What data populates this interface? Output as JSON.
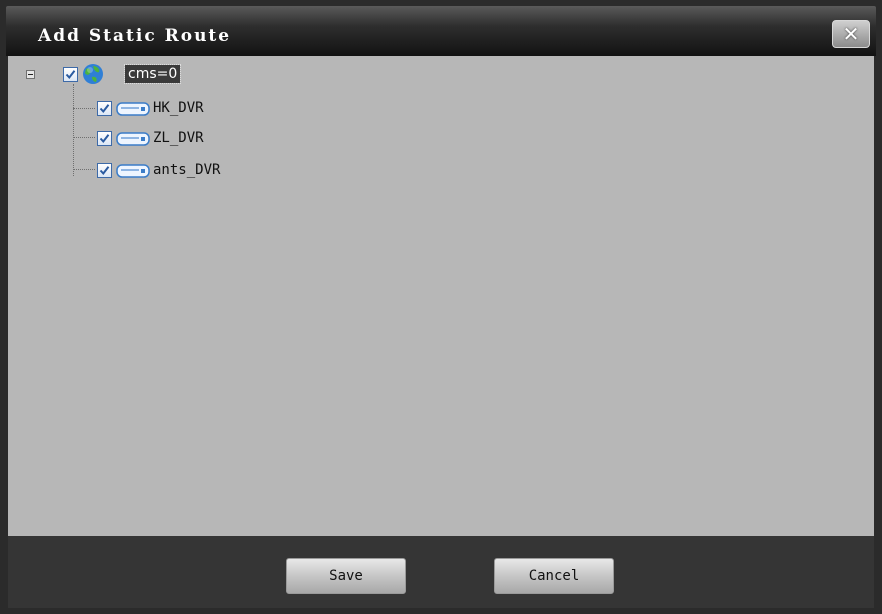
{
  "dialog": {
    "title": "Add Static Route",
    "close_glyph": "✕"
  },
  "tree": {
    "root": {
      "label": "cms=0",
      "checked": true,
      "expanded": true,
      "icon": "globe-icon",
      "children": [
        {
          "label": "HK_DVR",
          "checked": true,
          "icon": "dvr-device-icon"
        },
        {
          "label": "ZL_DVR",
          "checked": true,
          "icon": "dvr-device-icon"
        },
        {
          "label": "ants_DVR",
          "checked": true,
          "icon": "dvr-device-icon"
        }
      ]
    }
  },
  "buttons": {
    "save_label": "Save",
    "cancel_label": "Cancel"
  },
  "colors": {
    "tree_background": "#b7b7b7",
    "title_bar": "#1a1a1a",
    "bottom_bar": "#353535",
    "checkbox_border": "#3d6aa8"
  }
}
